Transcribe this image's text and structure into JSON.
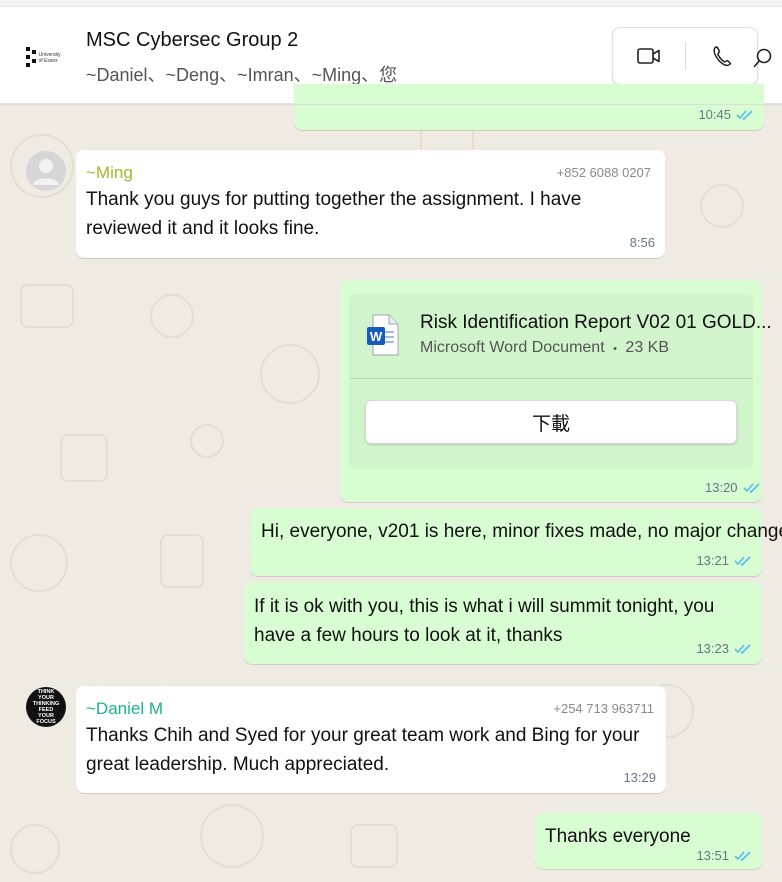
{
  "header": {
    "title": "MSC Cybersec Group 2",
    "members": "~Daniel、~Deng、~Imran、~Ming、您",
    "logo_text": "University of Essex"
  },
  "messages": {
    "m0": {
      "time": "10:45"
    },
    "m1": {
      "sender": "~Ming",
      "phone": "+852 6088 0207",
      "text": "Thank you guys for putting together the assignment.  I have reviewed it and it looks fine.",
      "time": "8:56"
    },
    "m2": {
      "file_name": "Risk Identification Report V02 01 GOLD...",
      "file_type": "Microsoft Word Document",
      "file_size": "23 KB",
      "separator": "•",
      "download_label": "下載",
      "time": "13:20"
    },
    "m3": {
      "text": "Hi, everyone, v201 is here, minor fixes made, no major change",
      "time": "13:21"
    },
    "m4": {
      "text": "If it is ok with you, this is what i will summit tonight, you have a few hours to look at it, thanks",
      "time": "13:23"
    },
    "m5": {
      "sender": "~Daniel M",
      "phone": "+254 713 963711",
      "text": "Thanks Chih and Syed for your great team  work and Bing for your great leadership. Much appreciated.",
      "time": "13:29",
      "avatar_text": "THINK YOUR THINKING FEED YOUR FOCUS"
    },
    "m6": {
      "text": "Thanks everyone",
      "time": "13:51"
    }
  },
  "colors": {
    "outgoing_bubble": "#d9fdd3",
    "incoming_bubble": "#ffffff",
    "chat_background": "#efeae2",
    "read_tick": "#53bdeb",
    "sender_ming": "#a4b82b",
    "sender_daniel": "#1fb28f"
  },
  "icons": [
    "video-call-icon",
    "voice-call-icon",
    "search-icon",
    "double-check-icon",
    "word-doc-icon",
    "default-avatar-icon"
  ]
}
